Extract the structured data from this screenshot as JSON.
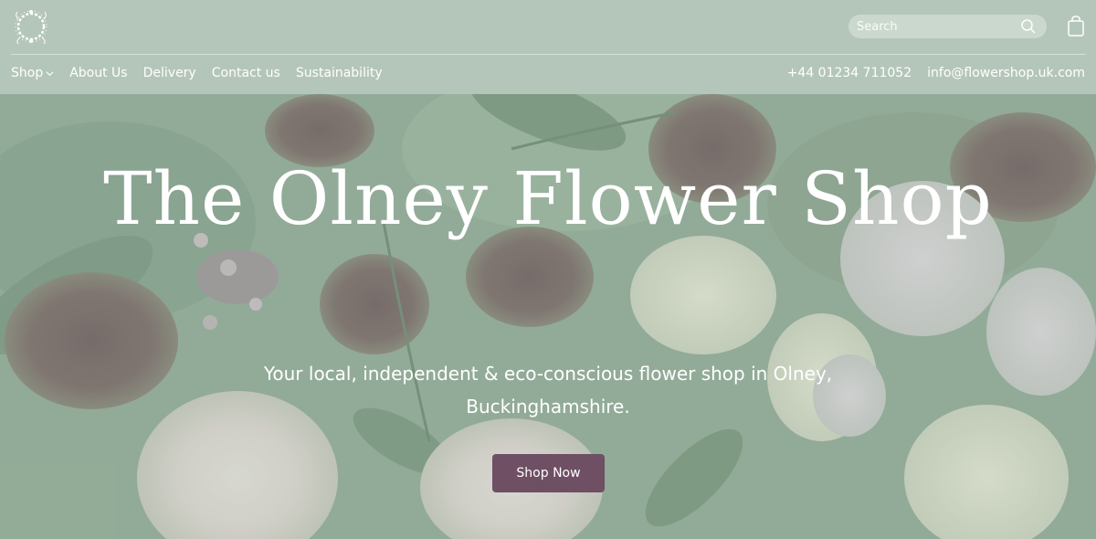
{
  "header": {
    "logo": "wreath-logo",
    "search": {
      "placeholder": "Search",
      "icon": "search-icon"
    },
    "cart_icon": "shopping-bag-icon"
  },
  "nav": {
    "items": [
      {
        "label": "Shop",
        "has_dropdown": true
      },
      {
        "label": "About Us"
      },
      {
        "label": "Delivery"
      },
      {
        "label": "Contact us"
      },
      {
        "label": "Sustainability"
      }
    ],
    "phone": "+44 01234 711052",
    "email": "info@flowershop.uk.com"
  },
  "hero": {
    "title": "The Olney Flower Shop",
    "subtitle": "Your local, independent & eco-conscious flower shop in Olney, Buckinghamshire.",
    "button_label": "Shop Now"
  },
  "colors": {
    "header_bg": "#b4c6b9",
    "button_bg": "#6e4f63",
    "text": "#ffffff"
  }
}
